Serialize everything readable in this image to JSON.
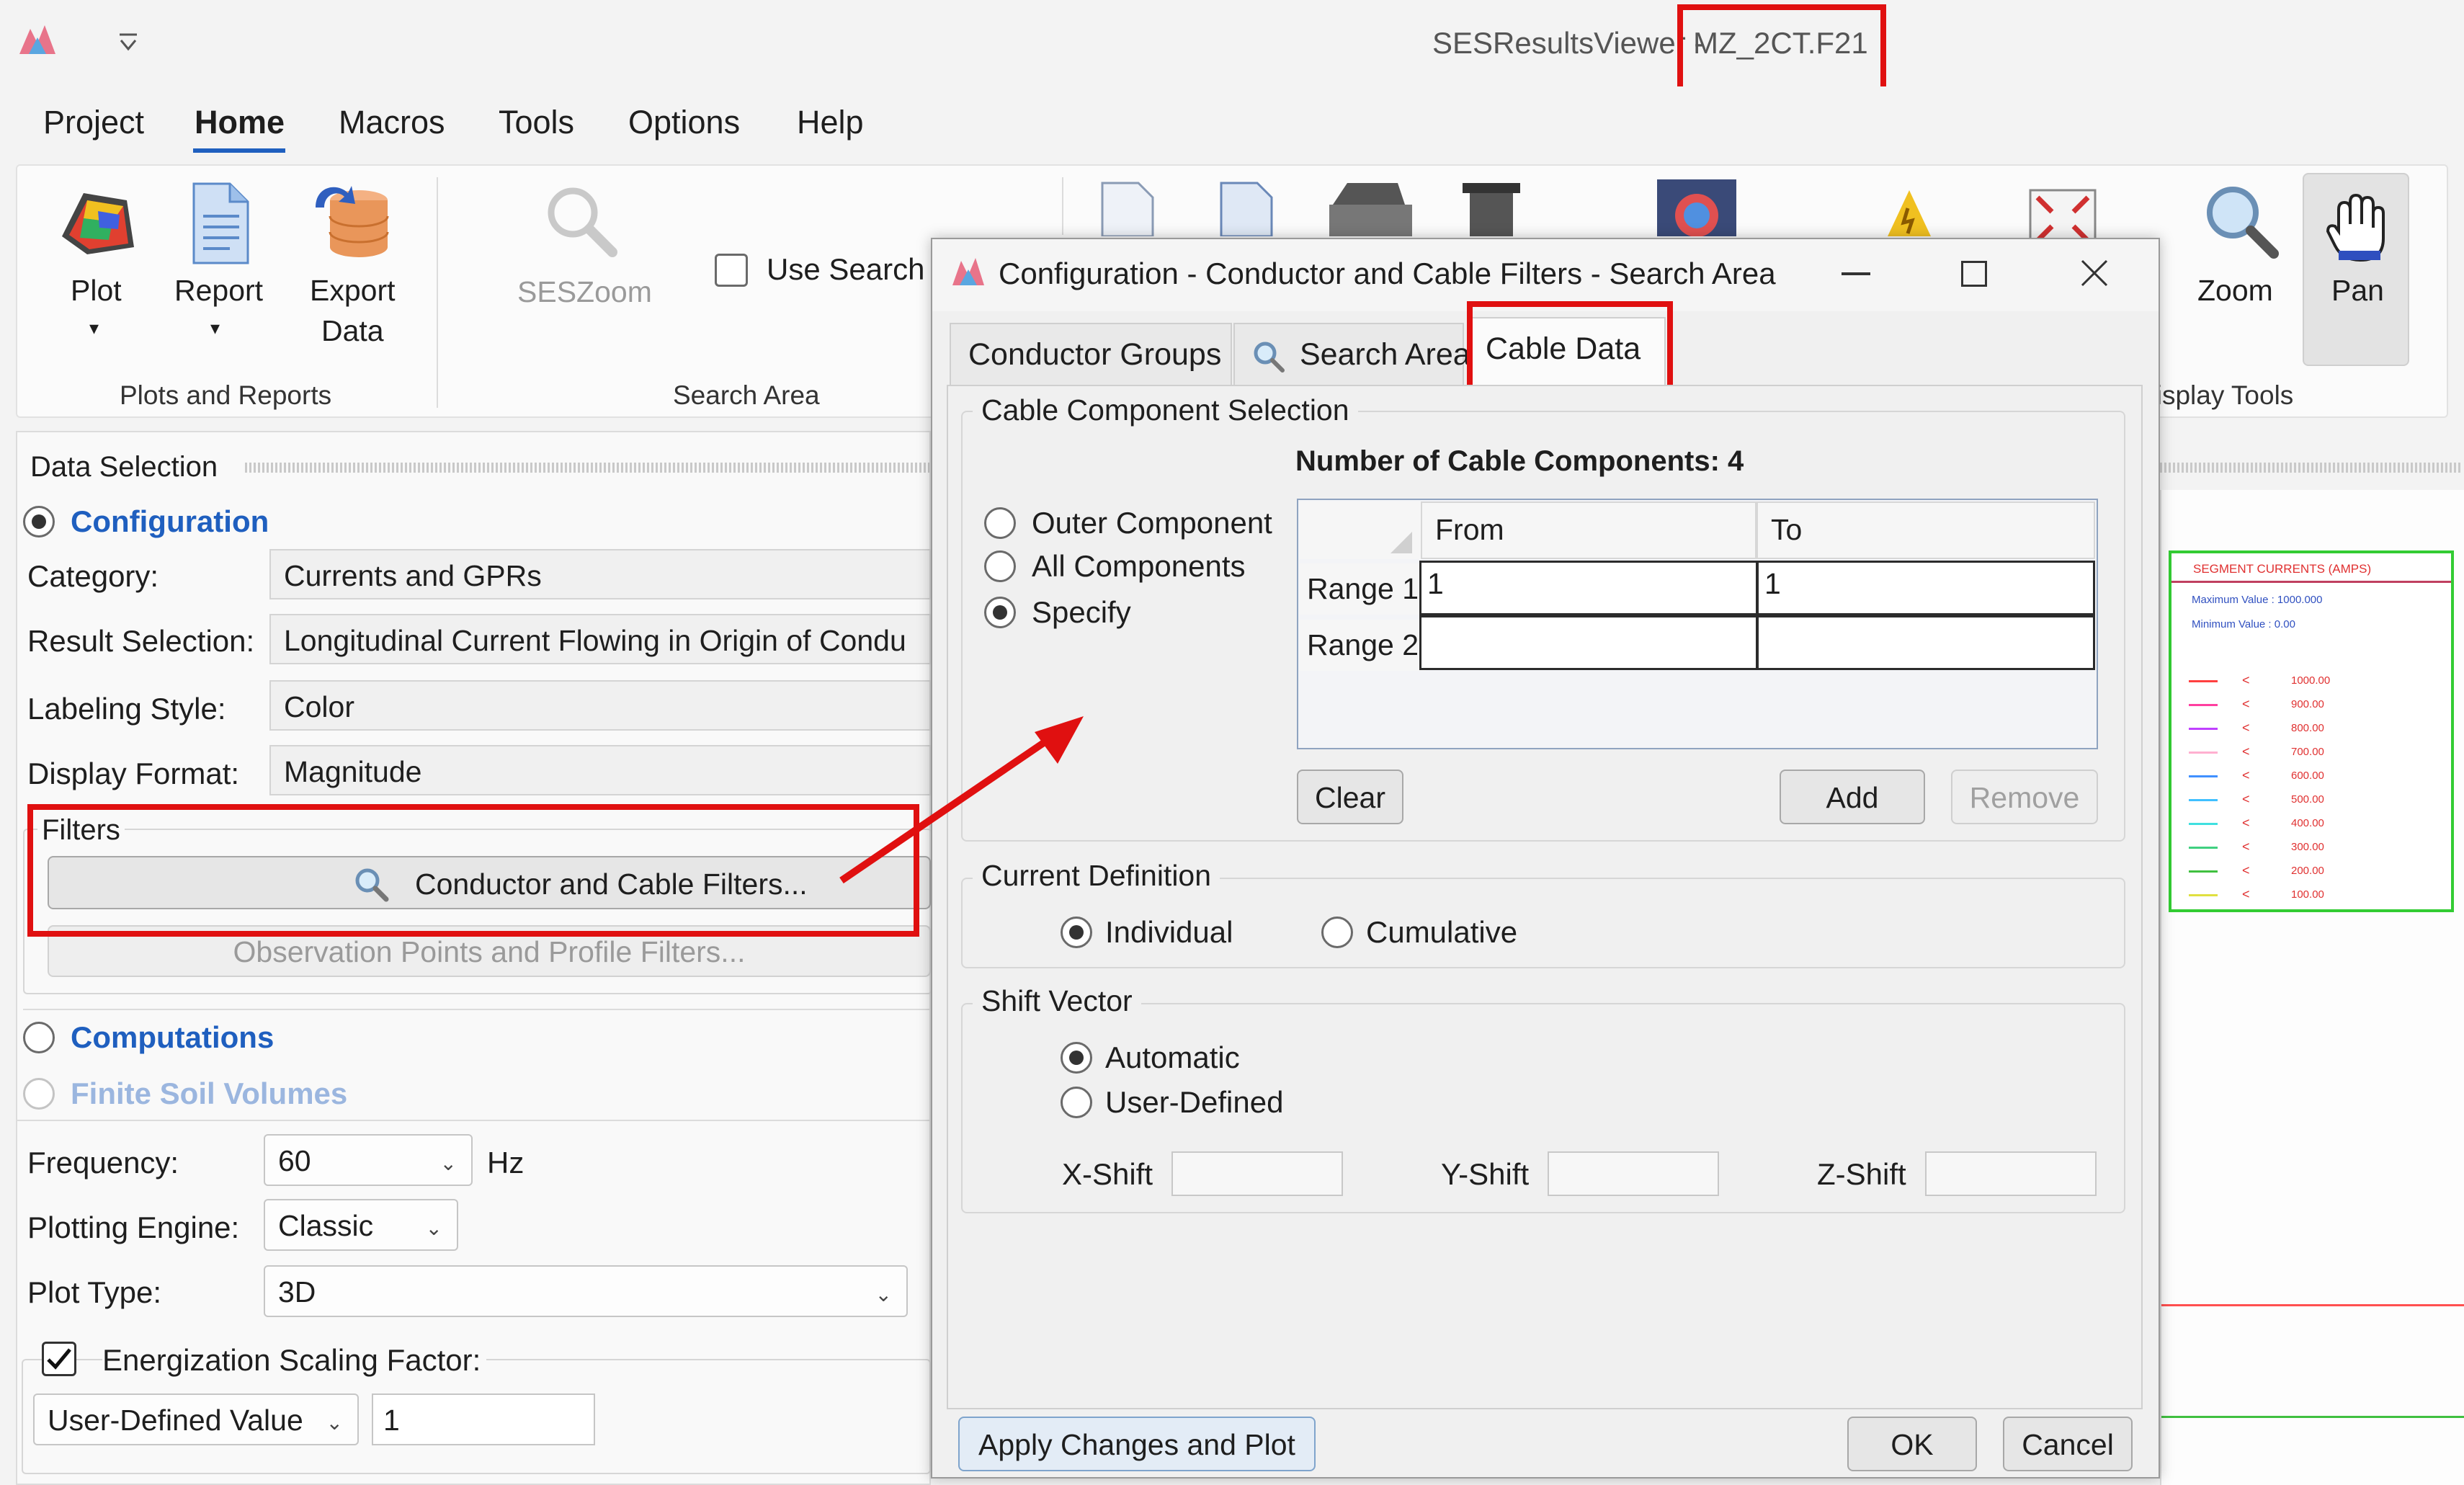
{
  "window": {
    "app_title": "SESResultsViewer - ",
    "file_name": "MZ_2CT.F21"
  },
  "menu": [
    "Project",
    "Home",
    "Macros",
    "Tools",
    "Options",
    "Help"
  ],
  "ribbon": {
    "plot": "Plot",
    "report": "Report",
    "export_line1": "Export",
    "export_line2": "Data",
    "plots_group": "Plots and Reports",
    "seszoom": "SESZoom",
    "use_search": "Use Search A",
    "search_group": "Search Area",
    "zoom": "Zoom",
    "pan": "Pan",
    "display_group": "Display Tools"
  },
  "data_selection": {
    "title": "Data Selection",
    "configuration": "Configuration",
    "category_label": "Category:",
    "category_value": "Currents and GPRs",
    "result_label": "Result Selection:",
    "result_value": "Longitudinal Current Flowing in Origin of Condu",
    "labeling_label": "Labeling Style:",
    "labeling_value": "Color",
    "display_label": "Display Format:",
    "display_value": "Magnitude",
    "filters_title": "Filters",
    "conductor_filters_btn": "Conductor and Cable Filters...",
    "observation_btn": "Observation Points and Profile Filters...",
    "computations": "Computations",
    "finite_soil": "Finite Soil Volumes",
    "frequency_label": "Frequency:",
    "frequency_value": "60",
    "hz": "Hz",
    "engine_label": "Plotting Engine:",
    "engine_value": "Classic",
    "plot_type_label": "Plot Type:",
    "plot_type_value": "3D",
    "energization_label": "Energization Scaling Factor:",
    "scaling_mode": "User-Defined Value",
    "scaling_value": "1"
  },
  "dialog": {
    "title": "Configuration - Conductor and Cable Filters - Search Area",
    "tabs": [
      "Conductor Groups",
      "Search Area",
      "Cable Data"
    ],
    "cable_selection_title": "Cable Component Selection",
    "num_components": "Number of Cable Components: 4",
    "options": [
      "Outer Component",
      "All Components",
      "Specify"
    ],
    "table_headers": [
      "From",
      "To"
    ],
    "rows": [
      {
        "label": "Range 1",
        "from": "1",
        "to": "1"
      },
      {
        "label": "Range 2",
        "from": "",
        "to": ""
      }
    ],
    "clear": "Clear",
    "add": "Add",
    "remove": "Remove",
    "current_def_title": "Current Definition",
    "individual": "Individual",
    "cumulative": "Cumulative",
    "shift_title": "Shift Vector",
    "automatic": "Automatic",
    "user_defined": "User-Defined",
    "x_shift": "X-Shift",
    "y_shift": "Y-Shift",
    "z_shift": "Z-Shift",
    "apply": "Apply Changes and Plot",
    "ok": "OK",
    "cancel": "Cancel"
  },
  "legend": {
    "title": "SEGMENT CURRENTS (AMPS)",
    "max": "Maximum Value :   1000.000",
    "min": "Minimum Value :    0.00",
    "values": [
      "1000.00",
      "900.00",
      "800.00",
      "700.00",
      "600.00",
      "500.00",
      "400.00",
      "300.00",
      "200.00",
      "100.00"
    ],
    "colors": [
      "#ff4040",
      "#ff40a0",
      "#c040ff",
      "#ffb0d0",
      "#4090ff",
      "#40c0ff",
      "#40e0e0",
      "#40d080",
      "#40c040",
      "#e0e040"
    ]
  },
  "annotation_color": "#e01010"
}
